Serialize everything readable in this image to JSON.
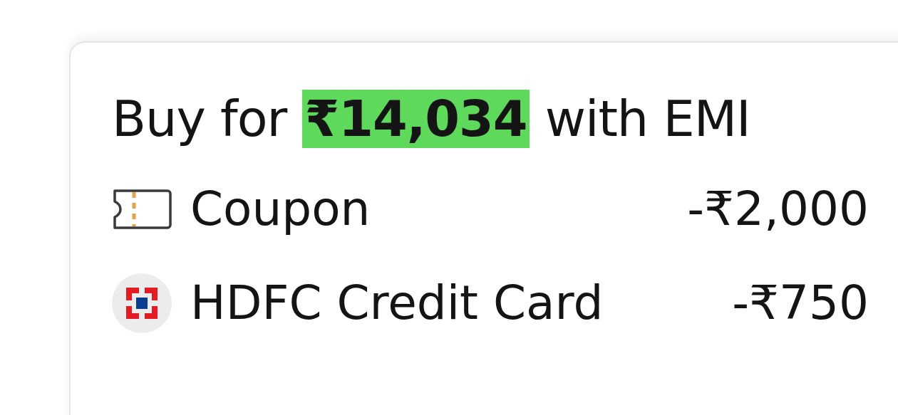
{
  "heading": {
    "prefix": "Buy for",
    "amount": "₹14,034",
    "suffix": "with EMI"
  },
  "offers": [
    {
      "kind": "coupon",
      "label": "Coupon",
      "amount": "-₹2,000"
    },
    {
      "kind": "bank",
      "label": "HDFC Credit Card",
      "amount": "-₹750"
    }
  ]
}
